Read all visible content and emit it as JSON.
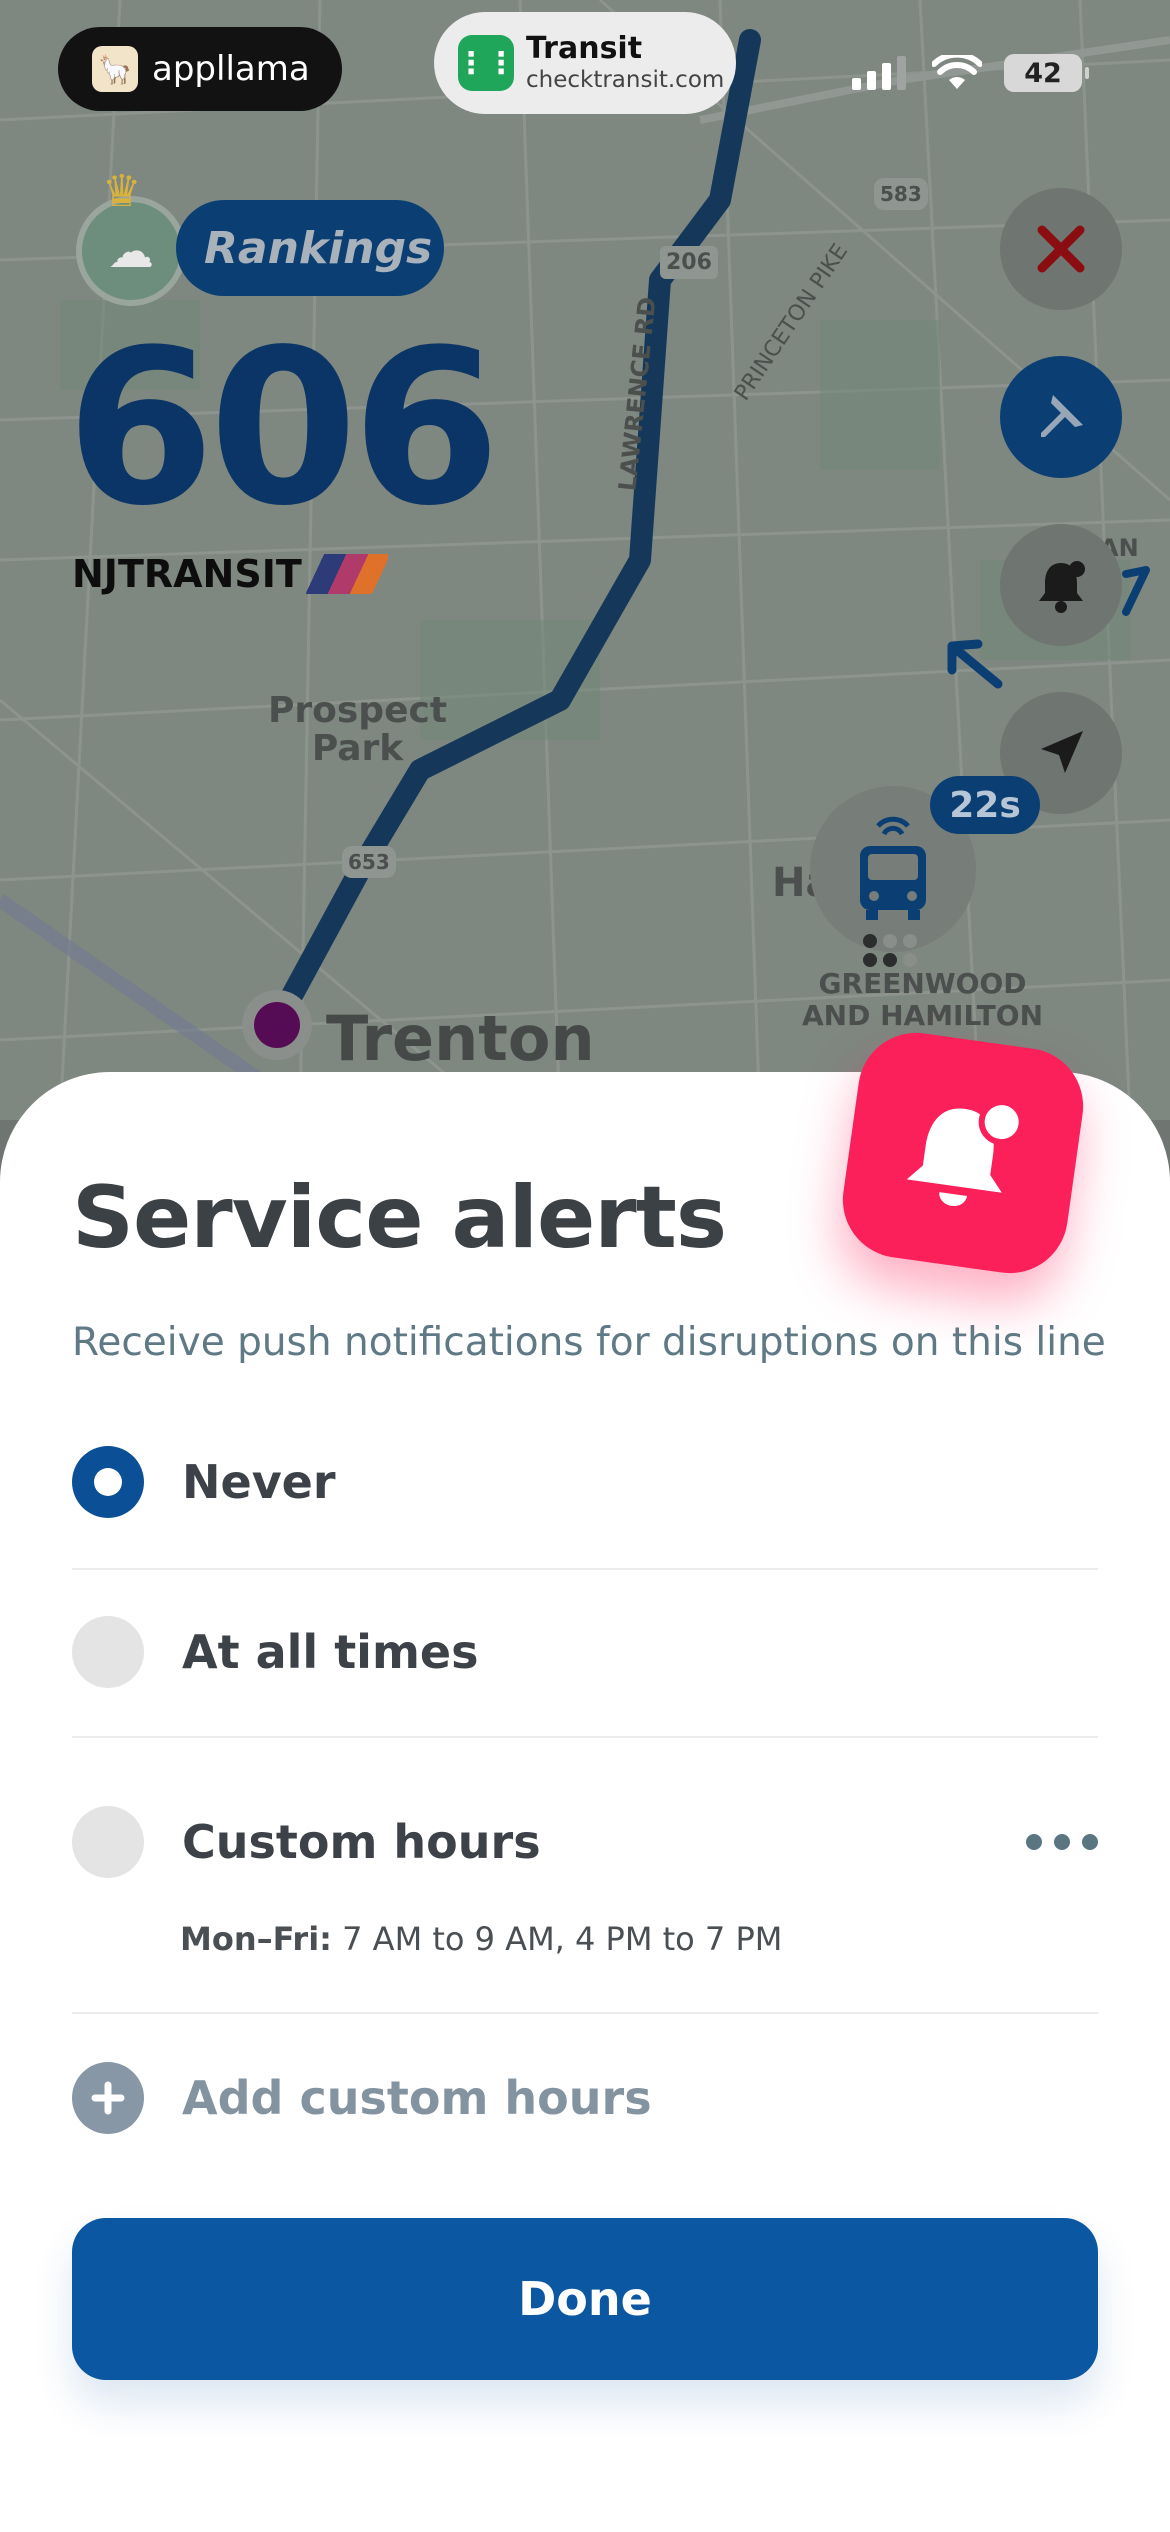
{
  "status_bar": {
    "applet_name": "appllama",
    "transit_title": "Transit",
    "transit_url": "checktransit.com",
    "battery": "42"
  },
  "route": {
    "rankings_label": "Rankings",
    "number": "606",
    "agency": "NJTRANSIT",
    "vehicle_eta": "22s"
  },
  "map": {
    "labels": {
      "prospect_park": "Prospect\nPark",
      "trenton": "Trenton",
      "greenwood": "GREENWOOD\nAND HAMILTON",
      "lawrence_rd": "LAWRENCE RD",
      "princeton_pike": "PRINCETON PIKE",
      "shield_206": "206",
      "shield_583": "583",
      "shield_653": "653",
      "partial_ha": "Ha",
      "partial_an": "AN"
    }
  },
  "sheet": {
    "title": "Service alerts",
    "subtitle": "Receive push notifications for disruptions on this line",
    "options": [
      {
        "label": "Never",
        "selected": true
      },
      {
        "label": "At all times",
        "selected": false
      },
      {
        "label": "Custom hours",
        "selected": false
      }
    ],
    "custom_days": "Mon–Fri:",
    "custom_times": " 7 AM to 9 AM, 4 PM to 7 PM",
    "add_label": "Add custom hours",
    "done_label": "Done"
  },
  "colors": {
    "accent": "#0b57a2",
    "alert_badge": "#fb1f5a",
    "route_line": "#0b3f74"
  }
}
